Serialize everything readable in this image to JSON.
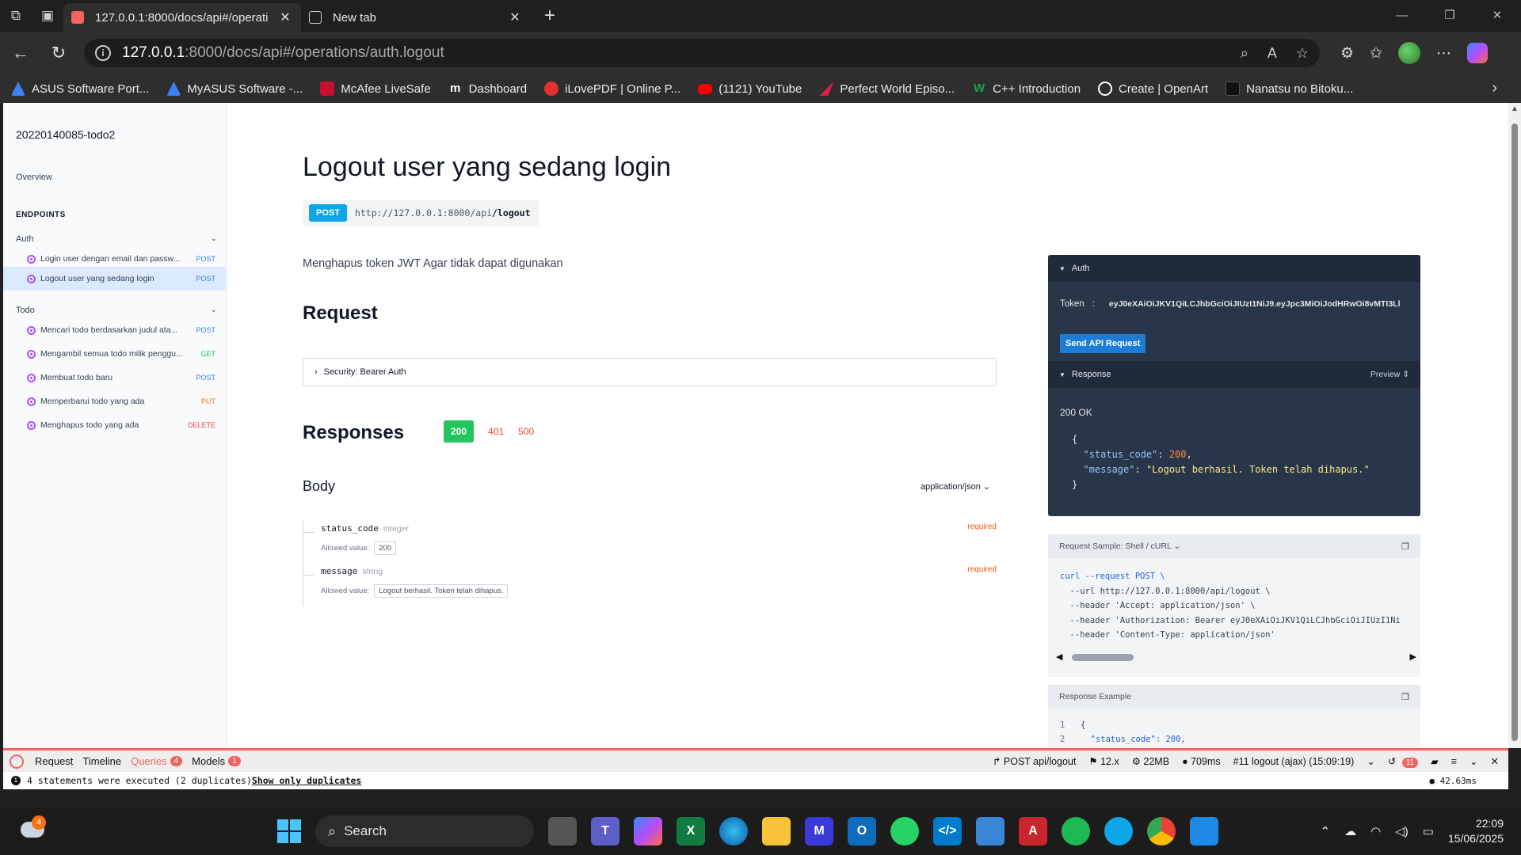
{
  "browser": {
    "tabs": [
      {
        "title": "127.0.0.1:8000/docs/api#/operati",
        "active": true
      },
      {
        "title": "New tab",
        "active": false
      }
    ],
    "url_host": "127.0.0.1",
    "url_path": ":8000/docs/api#/operations/auth.logout",
    "bookmarks": [
      {
        "label": "ASUS Software Port...",
        "color": "#3b82f6"
      },
      {
        "label": "MyASUS Software -...",
        "color": "#3b82f6"
      },
      {
        "label": "McAfee LiveSafe",
        "color": "#c8102e"
      },
      {
        "label": "Dashboard",
        "color": "#ffffff"
      },
      {
        "label": "iLovePDF | Online P...",
        "color": "#e5322d"
      },
      {
        "label": "(1121) YouTube",
        "color": "#ff0000"
      },
      {
        "label": "Perfect World Episo...",
        "color": "#e11d48"
      },
      {
        "label": "C++ Introduction",
        "color": "#16a34a"
      },
      {
        "label": "Create | OpenArt",
        "color": "#ffffff"
      },
      {
        "label": "Nanatsu no Bitoku...",
        "color": "#111111"
      }
    ]
  },
  "sidebar": {
    "project": "20220140085-todo2",
    "overview": "Overview",
    "endpoints_heading": "ENDPOINTS",
    "groups": [
      {
        "name": "Auth",
        "items": [
          {
            "label": "Login user dengan email dan passw...",
            "method": "POST",
            "active": false
          },
          {
            "label": "Logout user yang sedang login",
            "method": "POST",
            "active": true
          }
        ]
      },
      {
        "name": "Todo",
        "items": [
          {
            "label": "Mencari todo berdasarkan judul ata...",
            "method": "POST",
            "active": false
          },
          {
            "label": "Mengambil semua todo milik penggu...",
            "method": "GET",
            "active": false
          },
          {
            "label": "Membuat todo baru",
            "method": "POST",
            "active": false
          },
          {
            "label": "Memperbarui todo yang ada",
            "method": "PUT",
            "active": false
          },
          {
            "label": "Menghapus todo yang ada",
            "method": "DELETE",
            "active": false
          }
        ]
      }
    ]
  },
  "main": {
    "title": "Logout user yang sedang login",
    "method": "POST",
    "url_base": "http://127.0.0.1:8000/api",
    "url_path": "/logout",
    "description": "Menghapus token JWT Agar tidak dapat digunakan",
    "request_heading": "Request",
    "security_label": "Security: Bearer Auth",
    "responses_heading": "Responses",
    "status_codes": [
      "200",
      "401",
      "500"
    ],
    "body_heading": "Body",
    "content_type": "application/json",
    "allowed_label": "Allowed value:",
    "fields": [
      {
        "name": "status_code",
        "type": "integer",
        "required": "required",
        "allowed": "200"
      },
      {
        "name": "message",
        "type": "string",
        "required": "required",
        "allowed": "Logout berhasil. Token telah dihapus."
      }
    ]
  },
  "try_panel": {
    "auth_label": "Auth",
    "token_label": "Token",
    "token_value": "eyJ0eXAiOiJKV1QiLCJhbGciOiJIUzI1NiJ9.eyJpc3MiOiJodHRwOi8vMTI3Ll",
    "send_label": "Send API Request",
    "response_label": "Response",
    "preview_label": "Preview",
    "status": "200 OK",
    "json_status_key": "\"status_code\"",
    "json_status_val": "200",
    "json_message_key": "\"message\"",
    "json_message_val": "\"Logout berhasil. Token telah dihapus.\""
  },
  "request_sample": {
    "title": "Request Sample: Shell / cURL",
    "lines": [
      "curl --request POST \\",
      "  --url http://127.0.0.1:8000/api/logout \\",
      "  --header 'Accept: application/json' \\",
      "  --header 'Authorization: Bearer eyJ0eXAiOiJKV1QiLCJhbGciOiJIUzI1Ni",
      "  --header 'Content-Type: application/json'"
    ]
  },
  "response_example": {
    "title": "Response Example",
    "lines": [
      {
        "n": "1",
        "text": "{"
      },
      {
        "n": "2",
        "text": "  \"status_code\": 200,"
      }
    ]
  },
  "debugbar": {
    "tabs": [
      {
        "label": "Request",
        "badge": ""
      },
      {
        "label": "Timeline",
        "badge": ""
      },
      {
        "label": "Queries",
        "badge": "4"
      },
      {
        "label": "Models",
        "badge": "1"
      }
    ],
    "route": "POST api/logout",
    "version": "12.x",
    "memory": "22MB",
    "time": "709ms",
    "request_info": "#11 logout (ajax) (15:09:19)",
    "history_count": "11",
    "statement_text": "4 statements were executed (2 duplicates)",
    "show_duplicates": "Show only duplicates",
    "duration": "42.63ms"
  },
  "taskbar": {
    "weather_badge": "4",
    "search_placeholder": "Search",
    "time": "22:09",
    "date": "15/06/2025"
  }
}
